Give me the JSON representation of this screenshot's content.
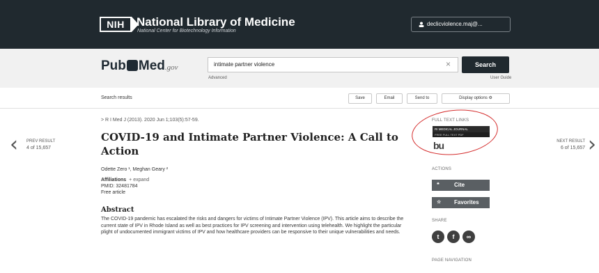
{
  "header": {
    "logo_text": "NIH",
    "org_title": "National Library of Medicine",
    "org_subtitle": "National Center for Biotechnology Information",
    "user_label": "declicviolence.maj@..."
  },
  "search": {
    "logo_pub": "Pub",
    "logo_med": "Med",
    "logo_gov": ".gov",
    "query": "intimate partner violence",
    "clear_symbol": "×",
    "button_label": "Search",
    "advanced_label": "Advanced",
    "user_guide_label": "User Guide"
  },
  "results_bar": {
    "label": "Search results",
    "save": "Save",
    "email": "Email",
    "send_to": "Send to",
    "display_options": "Display options"
  },
  "nav": {
    "prev_label": "PREV RESULT",
    "prev_count": "4 of 15,657",
    "next_label": "NEXT RESULT",
    "next_count": "6 of 15,657"
  },
  "article": {
    "citation": "> R I Med J (2013). 2020 Jun 1;103(5):57-59.",
    "title": "COVID-19 and Intimate Partner Violence: A Call to Action",
    "authors": "Odette Zero ¹, Meghan Geary ²",
    "affiliations": "Affiliations",
    "expand": "+ expand",
    "pmid": "PMID: 32481784",
    "free": "Free article",
    "abstract_heading": "Abstract",
    "abstract": "The COVID-19 pandemic has escalated the risks and dangers for victims of Intimate Partner Violence (IPV). This article aims to describe the current state of IPV in Rhode Island as well as best practices for IPV screening and intervention using telehealth. We highlight the particular plight of undocumented immigrant victims of IPV and how healthcare providers can be responsive to their unique vulnerabilities and needs."
  },
  "sidebar": {
    "full_text_links": "FULL TEXT LINKS",
    "journal_badge": "RI MEDICAL JOURNAL",
    "journal_badge_sub": "FREE FULL TEXT PDF",
    "bu_logo": "bu",
    "actions": "ACTIONS",
    "cite": "Cite",
    "favorites": "Favorites",
    "share": "SHARE",
    "page_navigation": "PAGE NAVIGATION"
  }
}
